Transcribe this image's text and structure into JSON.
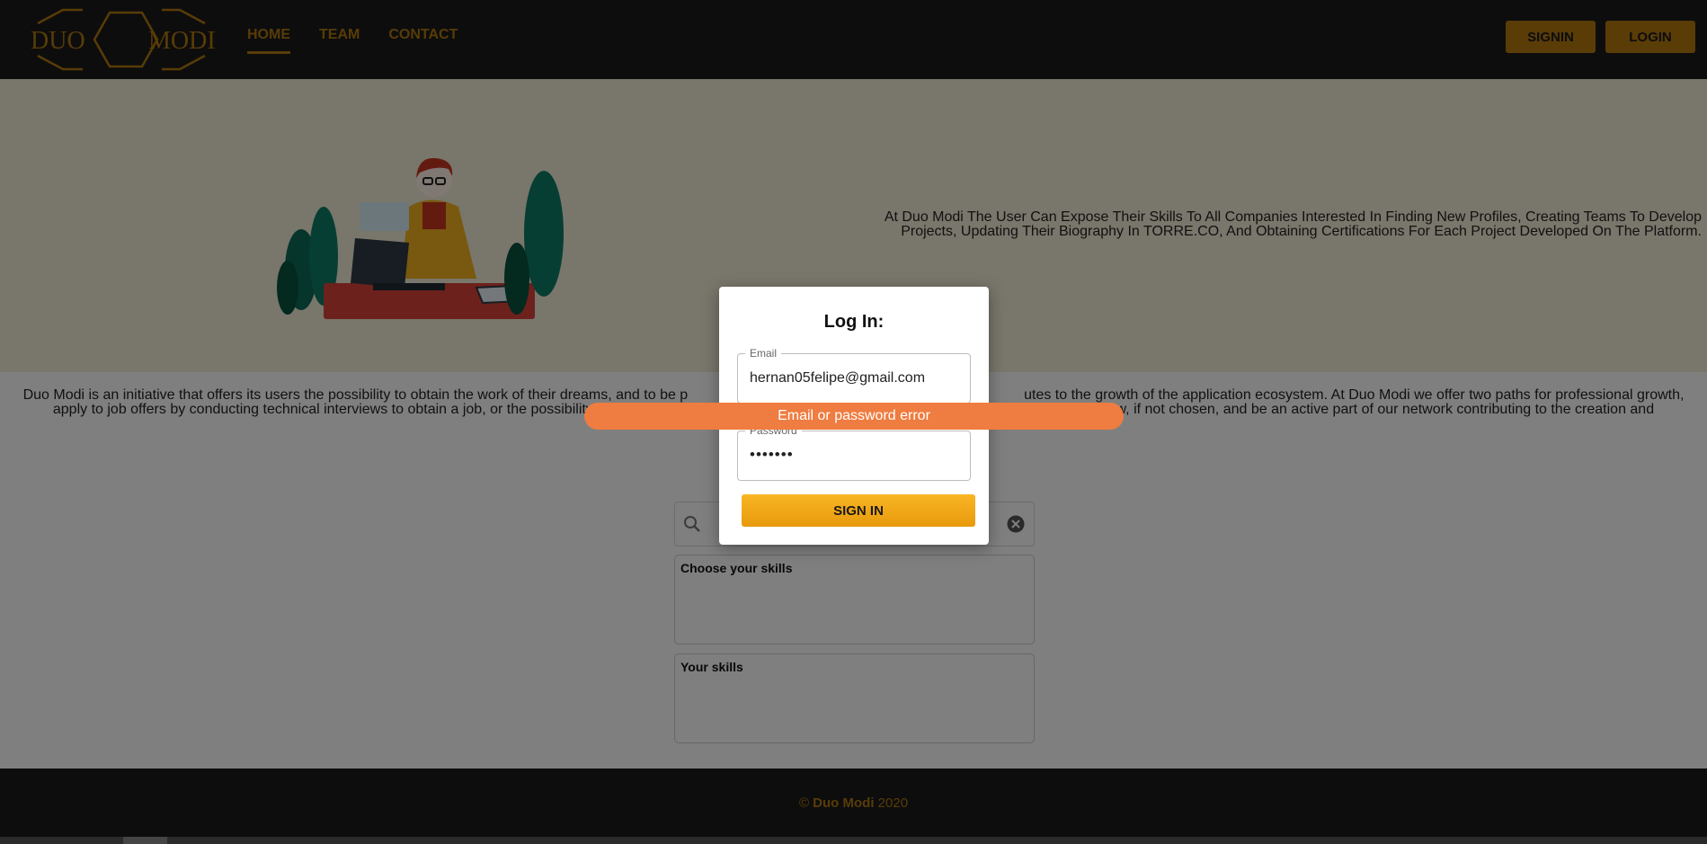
{
  "header": {
    "logo_left": "DUO",
    "logo_right": "MODI",
    "nav": [
      {
        "label": "HOME",
        "active": true
      },
      {
        "label": "TEAM",
        "active": false
      },
      {
        "label": "CONTACT",
        "active": false
      }
    ],
    "signin_label": "SIGNIN",
    "login_label": "LOGIN"
  },
  "hero": {
    "text": "At Duo Modi The User Can Expose Their Skills To All Companies Interested In Finding New Profiles, Creating Teams To Develop Projects, Updating Their Biography In TORRE.CO, And Obtaining Certifications For Each Project Developed On The Platform."
  },
  "intro": {
    "line1": "Duo Modi is an initiative that offers its users the possibility to obtain the work of their dreams, and to be p",
    "line1_end": "utes to the growth of the application ecosystem. At Duo Modi we offer two paths for professional growth,",
    "line2": "apply to job offers by conducting technical interviews to obtain a job, or the possibility t",
    "line2_end": "ew, if not chosen, and be an active part of our network contributing to the creation and"
  },
  "skills": {
    "choose_title": "Choose your skills",
    "yours_title": "Your skills"
  },
  "modal": {
    "title": "Log In:",
    "email_label": "Email",
    "email_value": "hernan05felipe@gmail.com",
    "password_label": "Password",
    "password_value": "•••••••",
    "submit_label": "SIGN IN"
  },
  "toast": {
    "message": "Email or password error"
  },
  "footer": {
    "copyright": "©",
    "brand": "Duo Modi",
    "year": "2020"
  },
  "colors": {
    "accent": "#b0780f",
    "toast": "#ef7c40",
    "header_bg": "#1b1b1b"
  },
  "icons": [
    "search-icon",
    "clear-icon"
  ]
}
